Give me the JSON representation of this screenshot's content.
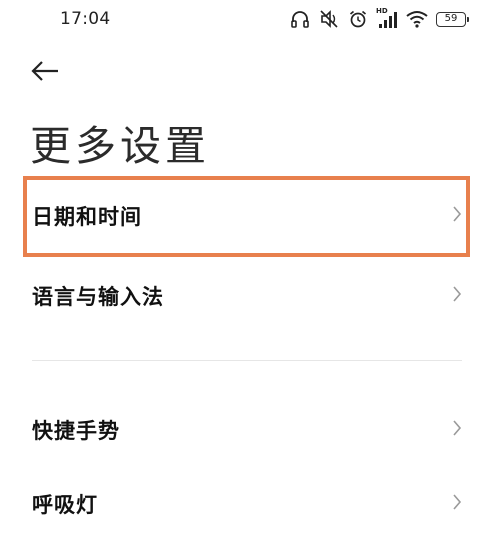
{
  "status_bar": {
    "time": "17:04",
    "hd_label": "HD",
    "battery_level": "59"
  },
  "page": {
    "title": "更多设置"
  },
  "settings": {
    "items": [
      {
        "label": "日期和时间"
      },
      {
        "label": "语言与输入法"
      },
      {
        "label": "快捷手势"
      },
      {
        "label": "呼吸灯"
      }
    ]
  },
  "colors": {
    "highlight": "#e8804d",
    "text": "#111111",
    "chevron": "#9a9a9a",
    "divider": "#e6e6e6"
  }
}
